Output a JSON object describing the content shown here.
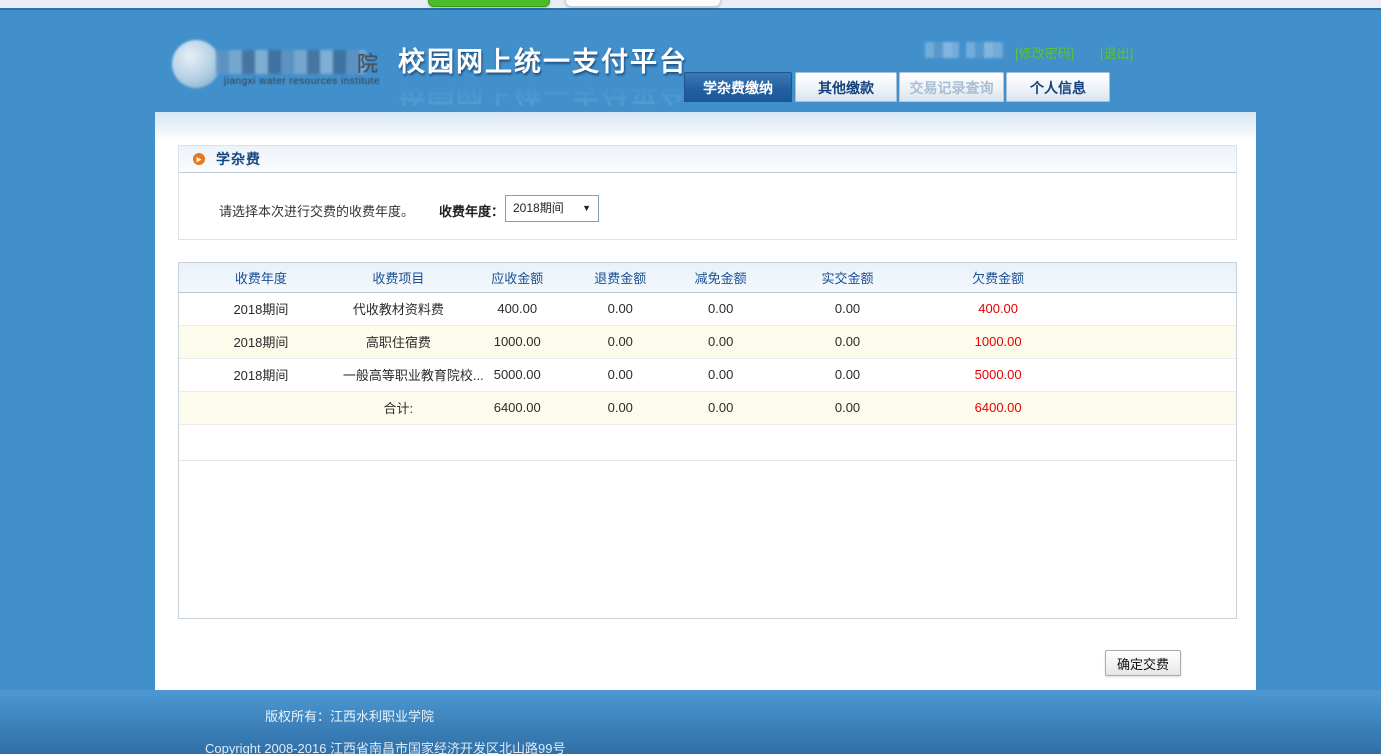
{
  "header": {
    "title": "校园网上统一支付平台",
    "logo": {
      "visible_char": "院",
      "subtext": "jiangxi water resources institute"
    },
    "user_bar": {
      "change_password": "[修改密码]",
      "logout": "[退出]"
    },
    "tabs": [
      {
        "label": "学杂费缴纳",
        "state": "active"
      },
      {
        "label": "其他缴款",
        "state": "normal"
      },
      {
        "label": "交易记录查询",
        "state": "disabled"
      },
      {
        "label": "个人信息",
        "state": "normal"
      }
    ]
  },
  "section": {
    "title": "学杂费",
    "instruction": "请选择本次进行交费的收费年度。",
    "year_label": "收费年度：",
    "year_value": "2018期间"
  },
  "table": {
    "columns": [
      "收费年度",
      "收费项目",
      "应收金额",
      "退费金额",
      "减免金额",
      "实交金额",
      "欠费金额"
    ],
    "rows": [
      [
        "2018期间",
        "代收教材资料费",
        "400.00",
        "0.00",
        "0.00",
        "0.00",
        "400.00"
      ],
      [
        "2018期间",
        "高职住宿费",
        "1000.00",
        "0.00",
        "0.00",
        "0.00",
        "1000.00"
      ],
      [
        "2018期间",
        "一般高等职业教育院校...",
        "5000.00",
        "0.00",
        "0.00",
        "0.00",
        "5000.00"
      ],
      [
        "",
        "合计:",
        "6400.00",
        "0.00",
        "0.00",
        "0.00",
        "6400.00"
      ]
    ]
  },
  "actions": {
    "confirm_label": "确定交费"
  },
  "footer": {
    "line1": "版权所有：江西水利职业学院",
    "line2": "Copyright 2008-2016 江西省南昌市国家经济开发区北山路99号"
  },
  "colors": {
    "page_blue": "#4190cc",
    "active_tab_blue": "#235f9f",
    "header_text_navy": "#1b4f93",
    "owed_red": "#e80000",
    "link_green": "#5dc93c",
    "bullet_orange": "#e8761a",
    "alt_row_cream": "#fdfcec"
  }
}
